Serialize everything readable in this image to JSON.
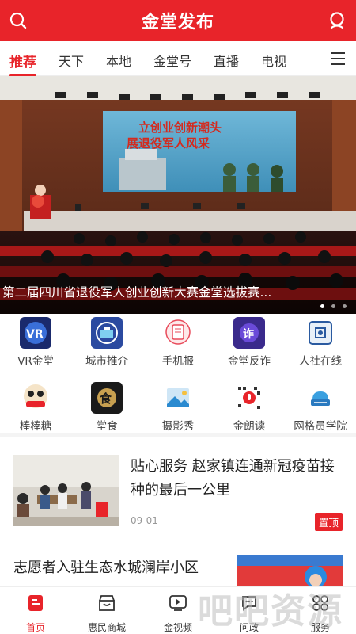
{
  "header": {
    "title": "金堂发布",
    "search_icon": "search-icon",
    "user_icon": "user-icon"
  },
  "tabs": [
    {
      "label": "推荐",
      "active": true
    },
    {
      "label": "天下"
    },
    {
      "label": "本地"
    },
    {
      "label": "金堂号"
    },
    {
      "label": "直播"
    },
    {
      "label": "电视"
    }
  ],
  "banner": {
    "caption": "第二届四川省退役军人创业创新大赛金堂选拔赛...",
    "screen_line1": "立创业创新潮头",
    "screen_line2": "展退役军人风采",
    "slide_count": 3,
    "active_slide": 1
  },
  "grid": [
    {
      "label": "VR金堂",
      "icon": "vr-icon"
    },
    {
      "label": "城市推介",
      "icon": "city-icon"
    },
    {
      "label": "手机报",
      "icon": "mobile-newspaper-icon"
    },
    {
      "label": "金堂反诈",
      "icon": "anti-fraud-icon"
    },
    {
      "label": "人社在线",
      "icon": "social-security-icon"
    },
    {
      "label": "棒棒糖",
      "icon": "lollipop-icon"
    },
    {
      "label": "堂食",
      "icon": "dining-icon"
    },
    {
      "label": "摄影秀",
      "icon": "photo-icon"
    },
    {
      "label": "金朗读",
      "icon": "reading-icon"
    },
    {
      "label": "网格员学院",
      "icon": "grid-academy-icon"
    }
  ],
  "news": [
    {
      "title": "贴心服务 赵家镇连通新冠疫苗接种的最后一公里",
      "date": "09-01",
      "badge": "置顶"
    },
    {
      "title": "志愿者入驻生态水城澜岸小区"
    }
  ],
  "bottom_nav": [
    {
      "label": "首页",
      "icon": "home-icon",
      "active": true
    },
    {
      "label": "惠民商城",
      "icon": "shop-icon"
    },
    {
      "label": "金视频",
      "icon": "video-icon"
    },
    {
      "label": "问政",
      "icon": "chat-icon"
    },
    {
      "label": "服务",
      "icon": "services-icon"
    }
  ],
  "watermark": "吧吧资源",
  "colors": {
    "brand_red": "#e8242a"
  }
}
